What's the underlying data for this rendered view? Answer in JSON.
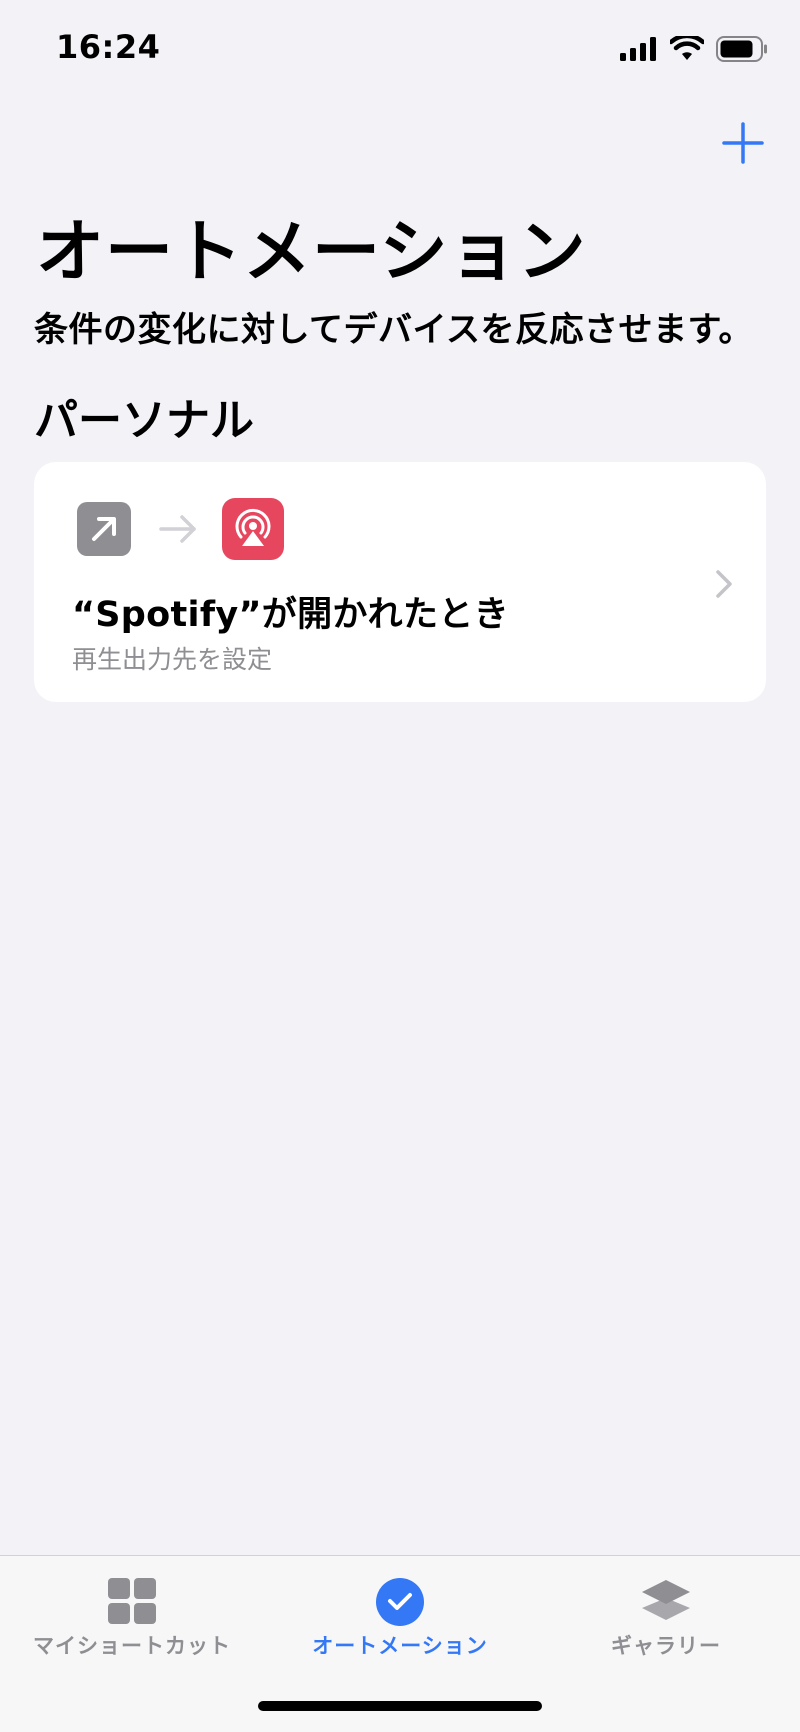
{
  "status_bar": {
    "time": "16:24",
    "icons": [
      "cellular-signal-icon",
      "wifi-icon",
      "battery-icon"
    ]
  },
  "header": {
    "add_button_icon": "plus-icon",
    "title": "オートメーション",
    "subtitle": "条件の変化に対してデバイスを反応させます。"
  },
  "section": {
    "title": "パーソナル"
  },
  "automations": [
    {
      "trigger_icon": "app-open-arrow-icon",
      "action_icon": "airplay-audio-icon",
      "title": "“Spotify”が開かれたとき",
      "subtitle": "再生出力先を設定"
    }
  ],
  "tab_bar": {
    "tabs": [
      {
        "label": "マイショートカット",
        "icon": "grid-icon",
        "active": false
      },
      {
        "label": "オートメーション",
        "icon": "clock-check-icon",
        "active": true
      },
      {
        "label": "ギャラリー",
        "icon": "layers-icon",
        "active": false
      }
    ]
  },
  "colors": {
    "accent": "#3478f6",
    "background": "#f2f2f7",
    "secondary_text": "#8e8e93",
    "action_icon_bg": "#e7475e",
    "trigger_icon_bg": "#8e8e93"
  }
}
